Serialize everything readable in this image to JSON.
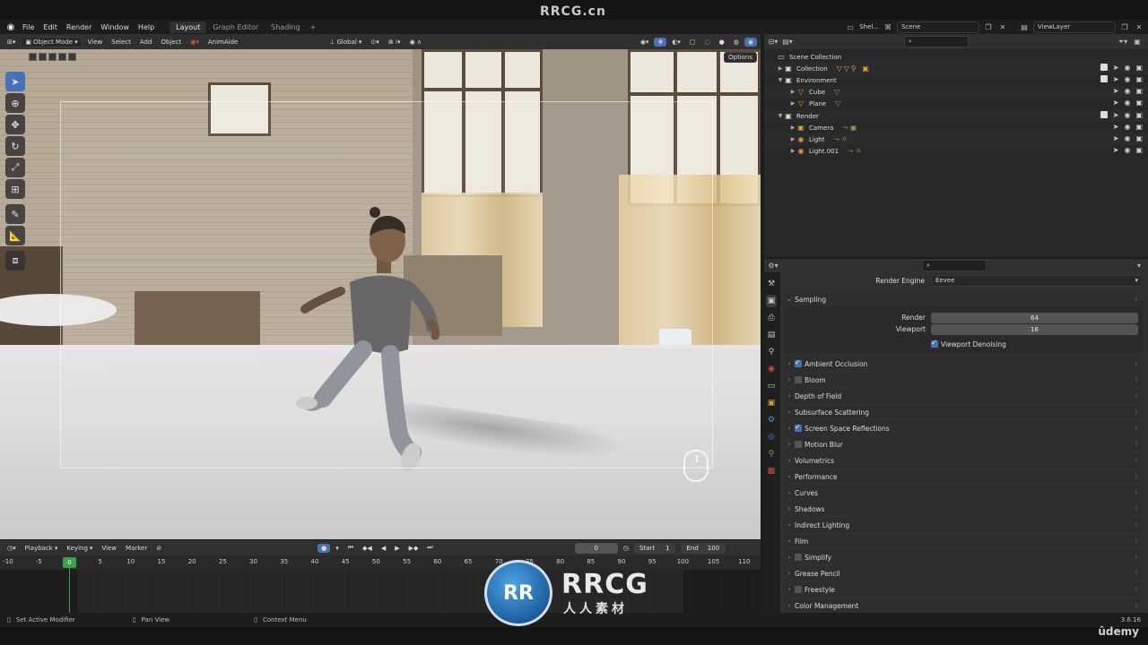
{
  "watermark": {
    "top": "RRCG.cn",
    "badge_main": "RRCG",
    "badge_sub": "人人素材",
    "badge_mark": "RR"
  },
  "menu": {
    "items": [
      "File",
      "Edit",
      "Render",
      "Window",
      "Help"
    ],
    "workspaces": [
      "Layout",
      "Graph Editor",
      "Shading"
    ],
    "active_workspace": "Layout",
    "scene_label": "Shel...",
    "scene_name": "Scene",
    "view_layer": "ViewLayer"
  },
  "viewport_header": {
    "mode": "Object Mode",
    "menus": [
      "View",
      "Select",
      "Add",
      "Object"
    ],
    "addon": "AnimAide",
    "orientation": "Global",
    "options_label": "Options"
  },
  "timeline": {
    "menus": [
      "Playback",
      "Keying",
      "View",
      "Marker"
    ],
    "current_frame": "0",
    "start_label": "Start",
    "start": "1",
    "end_label": "End",
    "end": "100",
    "ruler": [
      "-10",
      "-5",
      "0",
      "5",
      "10",
      "15",
      "20",
      "25",
      "30",
      "35",
      "40",
      "45",
      "50",
      "55",
      "60",
      "65",
      "70",
      "75",
      "80",
      "85",
      "90",
      "95",
      "100",
      "105",
      "110"
    ],
    "playhead": "0"
  },
  "status": {
    "left": "Set Active Modifier",
    "middle": "Pan View",
    "right": "Context Menu",
    "version": "3.6.16",
    "brand": "ûdemy"
  },
  "outliner": {
    "rows": [
      {
        "label": "Scene Collection",
        "indent": 0
      },
      {
        "label": "Collection",
        "indent": 1
      },
      {
        "label": "Environment",
        "indent": 1
      },
      {
        "label": "Cube",
        "indent": 2
      },
      {
        "label": "Plane",
        "indent": 2
      },
      {
        "label": "Render",
        "indent": 1
      },
      {
        "label": "Camera",
        "indent": 2
      },
      {
        "label": "Light",
        "indent": 2
      },
      {
        "label": "Light.001",
        "indent": 2
      }
    ]
  },
  "properties": {
    "render_engine_label": "Render Engine",
    "render_engine": "Eevee",
    "sampling": {
      "title": "Sampling",
      "render_label": "Render",
      "render_value": "64",
      "viewport_label": "Viewport",
      "viewport_value": "16",
      "denoise_label": "Viewport Denoising"
    },
    "panels": [
      {
        "label": "Ambient Occlusion",
        "check": "on"
      },
      {
        "label": "Bloom",
        "check": "off"
      },
      {
        "label": "Depth of Field",
        "check": "none"
      },
      {
        "label": "Subsurface Scattering",
        "check": "none"
      },
      {
        "label": "Screen Space Reflections",
        "check": "on"
      },
      {
        "label": "Motion Blur",
        "check": "off"
      },
      {
        "label": "Volumetrics",
        "check": "none"
      },
      {
        "label": "Performance",
        "check": "none"
      },
      {
        "label": "Curves",
        "check": "none"
      },
      {
        "label": "Shadows",
        "check": "none"
      },
      {
        "label": "Indirect Lighting",
        "check": "none"
      },
      {
        "label": "Film",
        "check": "none"
      },
      {
        "label": "Simplify",
        "check": "off"
      },
      {
        "label": "Grease Pencil",
        "check": "none"
      },
      {
        "label": "Freestyle",
        "check": "off"
      },
      {
        "label": "Color Management",
        "check": "none"
      }
    ]
  },
  "colors": {
    "accent": "#4772b3",
    "playhead": "#3da04a",
    "panel": "#303030",
    "bg": "#1d1d1d"
  }
}
